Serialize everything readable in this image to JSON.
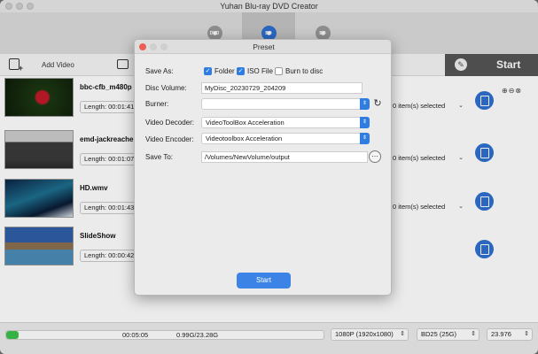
{
  "app": {
    "title": "Yuhan Blu-ray DVD Creator",
    "format_tabs": [
      {
        "label": "DVD",
        "active": false
      },
      {
        "label": "BD",
        "active": true
      },
      {
        "label": "BD",
        "active": false
      }
    ]
  },
  "actionbar": {
    "add_video_label": "Add Video",
    "start_label": "Start"
  },
  "videos": [
    {
      "name": "bbc-cfb_m480p",
      "length": "Length: 00:01:41",
      "selected": "0 item(s) selected"
    },
    {
      "name": "emd-jackreache",
      "length": "Length: 00:01:07",
      "selected": "0 item(s) selected"
    },
    {
      "name": "HD.wmv",
      "length": "Length: 00:01:43",
      "selected": "0 item(s) selected"
    },
    {
      "name": "SlideShow",
      "length": "Length: 00:00:42",
      "selected": ""
    }
  ],
  "bottom": {
    "progress_fraction": 0.04,
    "duration": "00:05:05",
    "capacity": "0.99G/23.28G",
    "resolution": "1080P (1920x1080)",
    "disc_type": "BD25 (25G)",
    "frame_rate": "23.976"
  },
  "dialog": {
    "title": "Preset",
    "save_as_label": "Save As:",
    "save_as_options": [
      {
        "label": "Folder",
        "checked": true
      },
      {
        "label": "ISO File",
        "checked": true
      },
      {
        "label": "Burn to disc",
        "checked": false
      }
    ],
    "disc_volume_label": "Disc Volume:",
    "disc_volume_value": "MyDisc_20230729_204209",
    "burner_label": "Burner:",
    "burner_value": "",
    "video_decoder_label": "Video Decoder:",
    "video_decoder_value": "VideoToolBox Acceleration",
    "video_encoder_label": "Video Encoder:",
    "video_encoder_value": "Videotoolbox Acceleration",
    "save_to_label": "Save To:",
    "save_to_value": "/Volumes/NewVolume/output",
    "start_button": "Start"
  },
  "colors": {
    "accent": "#2f7de1",
    "start_button": "#3c83e6",
    "progress": "#3bc24a",
    "start_bar": "#555555"
  }
}
